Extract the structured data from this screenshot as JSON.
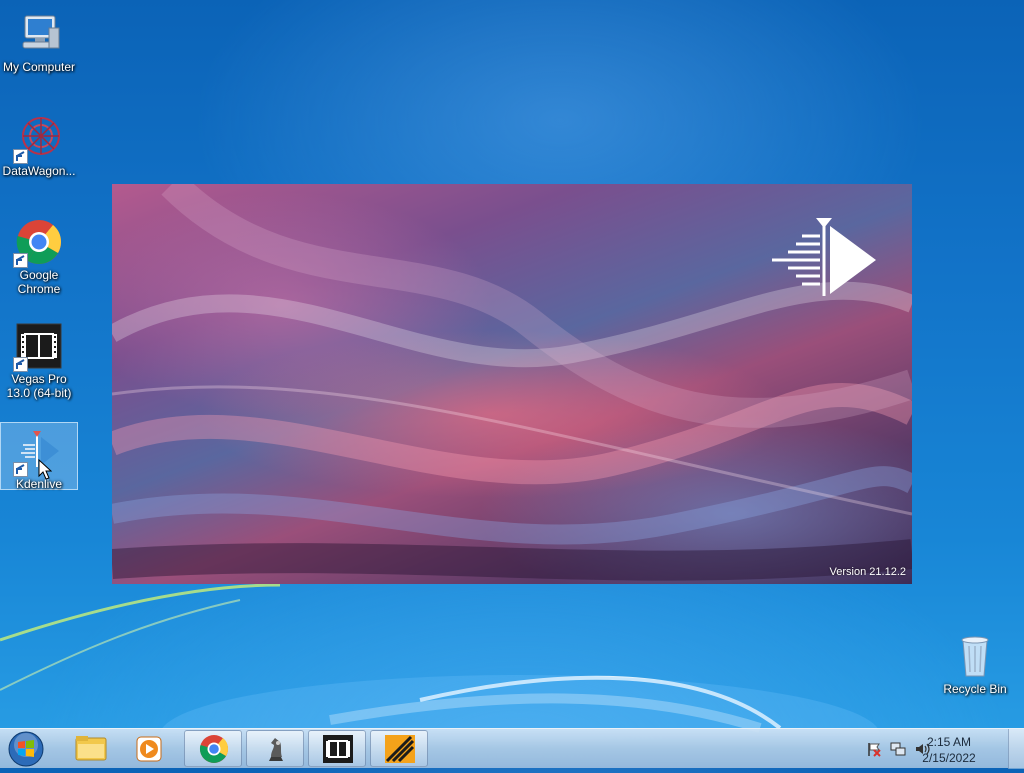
{
  "desktop": {
    "icons": [
      {
        "label": "My Computer",
        "icon": "computer-icon"
      },
      {
        "label": "DataWagon...",
        "icon": "datawagon-icon"
      },
      {
        "label": "Google Chrome",
        "icon": "chrome-icon"
      },
      {
        "label": "Vegas Pro 13.0 (64-bit)",
        "icon": "vegas-pro-icon"
      },
      {
        "label": "Kdenlive",
        "icon": "kdenlive-icon",
        "selected": true
      },
      {
        "label": "Recycle Bin",
        "icon": "recycle-bin-icon"
      }
    ]
  },
  "splash": {
    "app": "Kdenlive",
    "logo": "kdenlive-logo",
    "version": "Version 21.12.2"
  },
  "taskbar": {
    "start": "windows-orb-icon",
    "items": [
      {
        "icon": "file-explorer-icon",
        "active": false
      },
      {
        "icon": "media-player-icon",
        "active": false
      },
      {
        "icon": "chrome-icon",
        "active": true
      },
      {
        "icon": "chess-icon",
        "active": true
      },
      {
        "icon": "vegas-pro-icon",
        "active": true
      },
      {
        "icon": "kdenlive-taskbar-icon",
        "active": true
      }
    ],
    "tray": {
      "icons": [
        "action-center-flag-icon",
        "network-icon",
        "volume-icon"
      ],
      "time": "2:15 AM",
      "date": "2/15/2022"
    }
  },
  "colors": {
    "desktop_blue": "#1273c8",
    "taskbar": "#b4cbe3",
    "splash_pink": "#b45a8e",
    "splash_purple": "#3d2c55"
  }
}
